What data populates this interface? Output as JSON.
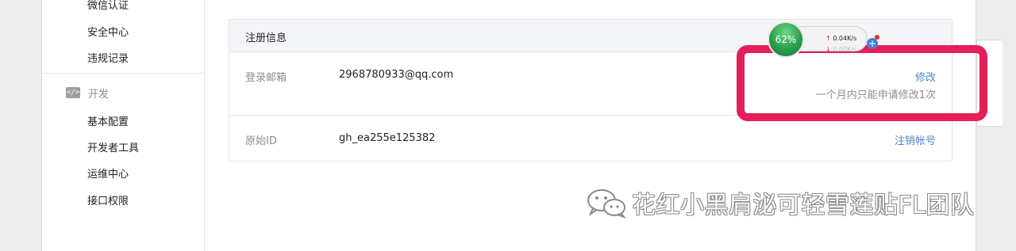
{
  "sidebar": {
    "items_top": [
      {
        "label": "微信认证"
      },
      {
        "label": "安全中心"
      },
      {
        "label": "违规记录"
      }
    ],
    "dev_section": {
      "icon": "code-icon",
      "icon_glyph": "</>",
      "label": "开发",
      "items": [
        {
          "label": "基本配置"
        },
        {
          "label": "开发者工具"
        },
        {
          "label": "运维中心"
        },
        {
          "label": "接口权限"
        }
      ]
    }
  },
  "registration": {
    "title": "注册信息",
    "rows": [
      {
        "label": "登录邮箱",
        "value": "2968780933@qq.com",
        "action": "修改",
        "note": "一个月内只能申请修改1次"
      },
      {
        "label": "原始ID",
        "value": "gh_ea255e125382",
        "action": "注销帐号"
      }
    ]
  },
  "net_monitor": {
    "percent": "62%",
    "upload": "0.04K/s",
    "download": "0.00K/s"
  },
  "watermark": {
    "text": "花红小黑肩泌可轻雪莲贴FL团队"
  },
  "colors": {
    "link": "#4f86c6",
    "highlight": "#e51e5a",
    "panel_header": "#f4f5f9"
  }
}
